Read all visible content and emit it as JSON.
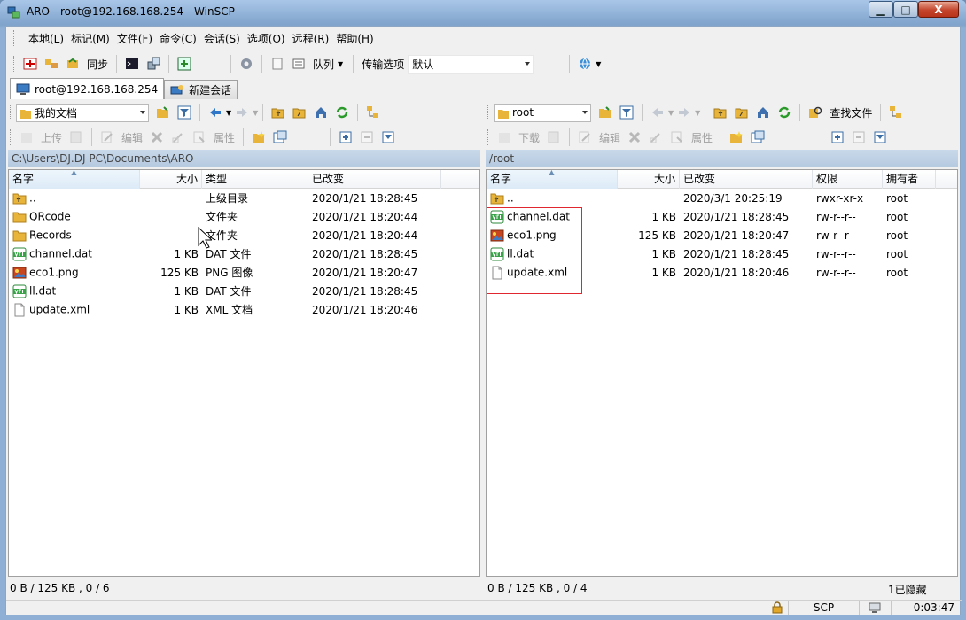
{
  "window": {
    "title": "ARO - root@192.168.168.254 - WinSCP",
    "min_label": "▁",
    "max_label": "□",
    "close_label": "X"
  },
  "menu": [
    "本地(L)",
    "标记(M)",
    "文件(F)",
    "命令(C)",
    "会话(S)",
    "选项(O)",
    "远程(R)",
    "帮助(H)"
  ],
  "toolbar": {
    "sync_label": "同步",
    "queue_label": "队列",
    "transfer_label": "传输选项",
    "transfer_value": "默认"
  },
  "tabs": [
    {
      "label": "root@192.168.168.254"
    },
    {
      "label": "新建会话"
    }
  ],
  "left": {
    "location": "我的文档",
    "actions": {
      "upload": "上传",
      "edit": "编辑",
      "properties": "属性"
    },
    "path": "C:\\Users\\DJ.DJ-PC\\Documents\\ARO",
    "columns": [
      "名字",
      "大小",
      "类型",
      "已改变"
    ],
    "rows": [
      {
        "name": "..",
        "size": "",
        "type": "上级目录",
        "changed": "2020/1/21   18:28:45",
        "icon": "parent-folder"
      },
      {
        "name": "QRcode",
        "size": "",
        "type": "文件夹",
        "changed": "2020/1/21   18:20:44",
        "icon": "folder"
      },
      {
        "name": "Records",
        "size": "",
        "type": "文件夹",
        "changed": "2020/1/21   18:20:44",
        "icon": "folder"
      },
      {
        "name": "channel.dat",
        "size": "1 KB",
        "type": "DAT 文件",
        "changed": "2020/1/21   18:28:45",
        "icon": "dat-file"
      },
      {
        "name": "eco1.png",
        "size": "125 KB",
        "type": "PNG 图像",
        "changed": "2020/1/21   18:20:47",
        "icon": "png-file"
      },
      {
        "name": "ll.dat",
        "size": "1 KB",
        "type": "DAT 文件",
        "changed": "2020/1/21   18:28:45",
        "icon": "dat-file"
      },
      {
        "name": "update.xml",
        "size": "1 KB",
        "type": "XML 文档",
        "changed": "2020/1/21   18:20:46",
        "icon": "xml-file"
      }
    ],
    "status": "0 B / 125 KB ,  0 / 6"
  },
  "right": {
    "location": "root",
    "find_label": "查找文件",
    "actions": {
      "download": "下载",
      "edit": "编辑",
      "properties": "属性"
    },
    "path": "/root",
    "columns": [
      "名字",
      "大小",
      "已改变",
      "权限",
      "拥有者"
    ],
    "rows": [
      {
        "name": "..",
        "size": "",
        "changed": "2020/3/1  20:25:19",
        "rights": "rwxr-xr-x",
        "owner": "root",
        "icon": "parent-folder"
      },
      {
        "name": "channel.dat",
        "size": "1 KB",
        "changed": "2020/1/21  18:28:45",
        "rights": "rw-r--r--",
        "owner": "root",
        "icon": "dat-file"
      },
      {
        "name": "eco1.png",
        "size": "125 KB",
        "changed": "2020/1/21  18:20:47",
        "rights": "rw-r--r--",
        "owner": "root",
        "icon": "png-file"
      },
      {
        "name": "ll.dat",
        "size": "1 KB",
        "changed": "2020/1/21  18:28:45",
        "rights": "rw-r--r--",
        "owner": "root",
        "icon": "dat-file"
      },
      {
        "name": "update.xml",
        "size": "1 KB",
        "changed": "2020/1/21  18:20:46",
        "rights": "rw-r--r--",
        "owner": "root",
        "icon": "xml-file"
      }
    ],
    "status": "0 B / 125 KB ,  0 / 4",
    "hidden": "1已隐藏"
  },
  "status": {
    "protocol": "SCP",
    "elapsed": "0:03:47"
  },
  "colors": {
    "highlight": "#e0262f",
    "folder": "#e8b43a",
    "path_bar": "#b5c9df"
  }
}
